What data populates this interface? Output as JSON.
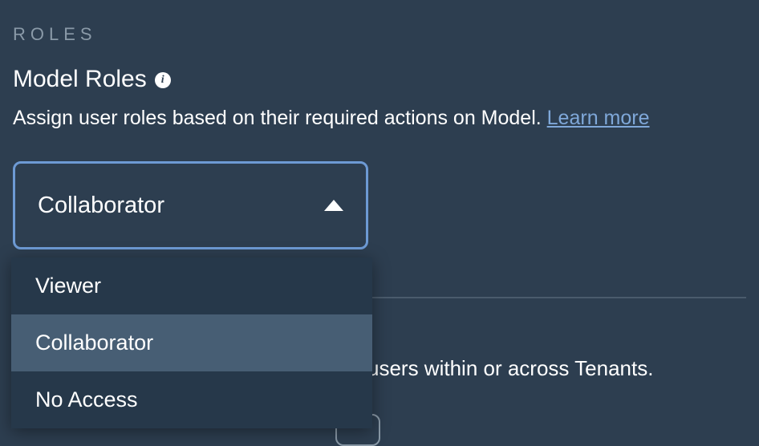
{
  "section": {
    "label": "ROLES",
    "heading": "Model Roles",
    "description_prefix": "Assign user roles based on their required actions on Model. ",
    "learn_more": "Learn more"
  },
  "dropdown": {
    "selected": "Collaborator",
    "options": [
      "Viewer",
      "Collaborator",
      "No Access"
    ]
  },
  "background_partial_text": "users within or across Tenants."
}
